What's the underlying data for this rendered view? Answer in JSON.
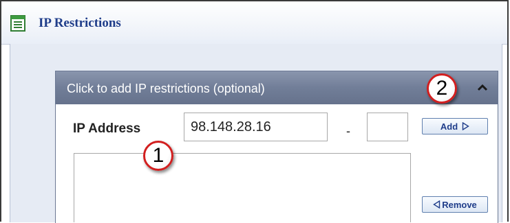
{
  "window": {
    "title": "IP Restrictions",
    "title_icon": "list-window-icon"
  },
  "panel": {
    "header_text": "Click to add IP restrictions (optional)",
    "collapse_icon": "chevron-up-icon"
  },
  "form": {
    "ip_label": "IP Address",
    "ip_start_value": "98.148.28.16",
    "range_separator": "-",
    "ip_end_value": ""
  },
  "buttons": {
    "add_label": "Add",
    "add_icon": "triangle-right-icon",
    "remove_label": "Remove",
    "remove_icon": "triangle-left-icon"
  },
  "callouts": {
    "one": "1",
    "two": "2"
  },
  "colors": {
    "title_text": "#1f3d8a",
    "panel_header": "#717e98",
    "callout_border": "#d21f1f",
    "content_background": "#e6ebf4"
  }
}
